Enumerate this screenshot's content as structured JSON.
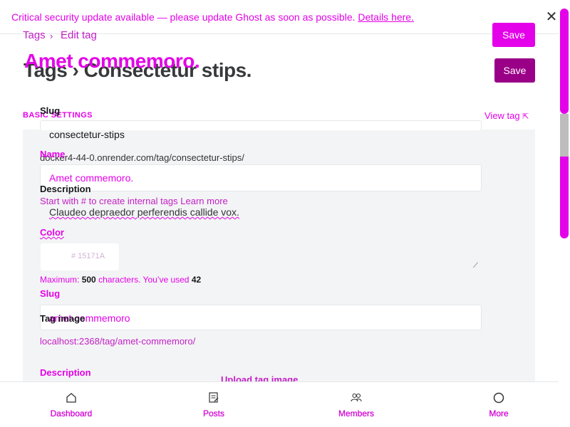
{
  "banner": {
    "text": "Critical security update available — please update Ghost as soon as possible.",
    "link": "Details here.",
    "close_icon": "close-icon"
  },
  "breadcrumb": {
    "tags": "Tags",
    "separator": "›",
    "edit_tag": "Edit tag"
  },
  "header": {
    "save_label": "Save",
    "save_label_secondary": "Save",
    "title_primary": "Amet commemoro.",
    "title_secondary": "Tags › Consectetur stips."
  },
  "settings": {
    "section_label": "BASIC SETTINGS",
    "view_tag": "View tag",
    "slug_label_top": "Slug",
    "slug_value_top": "consectetur-stips",
    "slug_url_top": "docker4-44-0.onrender.com/tag/consectetur-stips/",
    "name_label": "Name",
    "name_value": "Amet commemoro.",
    "name_hint": "Start with # to create internal tags",
    "name_hint_link": "Learn more",
    "description_label_top": "Description",
    "description_value": "Claudeo depraedor perferendis callide vox.",
    "color_label": "Color",
    "color_value": "# 15171A",
    "char_count_prefix": "Maximum:",
    "char_max": "500",
    "char_count_mid": "characters. You’ve used",
    "char_used": "42",
    "slug_label": "Slug",
    "slug_value": "amet-commemoro",
    "tag_image_label": "Tag image",
    "slug_url": "localhost:2368/tag/amet-commemoro/",
    "description_label": "Description",
    "upload_label": "Upload tag image"
  },
  "bottom_nav": {
    "items": [
      {
        "label": "Dashboard",
        "icon": "home-icon"
      },
      {
        "label": "Posts",
        "icon": "posts-icon"
      },
      {
        "label": "Members",
        "icon": "members-icon"
      },
      {
        "label": "More",
        "icon": "more-icon"
      }
    ]
  },
  "colors": {
    "accent": "#e400e8",
    "save_secondary": "#9a0087",
    "text_dark": "#15171a",
    "panel_bg": "#f3f4f5"
  }
}
